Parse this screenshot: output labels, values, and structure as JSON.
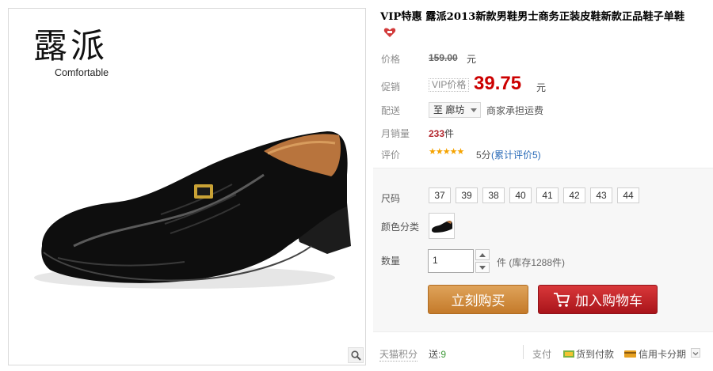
{
  "image": {
    "brand_cn": "露派",
    "brand_en": "Comfortable",
    "zoom_icon": "magnifier-icon"
  },
  "product": {
    "title": "VIP特惠 露派2013新款男鞋男士商务正装皮鞋新款正品鞋子单鞋",
    "badge_icon": "heart-badge-icon"
  },
  "price": {
    "label": "价格",
    "original": "159.00",
    "unit": "元"
  },
  "promo": {
    "label": "促销",
    "tag": "VIP价格",
    "price": "39.75",
    "unit": "元"
  },
  "shipping": {
    "label": "配送",
    "destination": "至 廊坊",
    "note": "商家承担运费"
  },
  "sales": {
    "label": "月销量",
    "count": "233",
    "unit": "件"
  },
  "rating": {
    "label": "评价",
    "stars": "★★★★★",
    "score": "5分",
    "link": "(累计评价5)",
    "star_color": "#f5a300"
  },
  "sku": {
    "size_label": "尺码",
    "sizes": [
      "37",
      "39",
      "38",
      "40",
      "41",
      "42",
      "43",
      "44"
    ],
    "color_label": "颜色分类",
    "qty_label": "数量",
    "qty_value": "1",
    "stock_note": "件 (库存1288件)"
  },
  "actions": {
    "buy_now": "立刻购买",
    "add_to_cart": "加入购物车",
    "buy_color": "#c47a2a",
    "cart_color": "#b3191f"
  },
  "footer": {
    "points_label": "天猫积分",
    "points_prefix": "送:",
    "points_value": "9",
    "pay_label": "支付",
    "pay_cod": "货到付款",
    "pay_card": "信用卡分期"
  }
}
